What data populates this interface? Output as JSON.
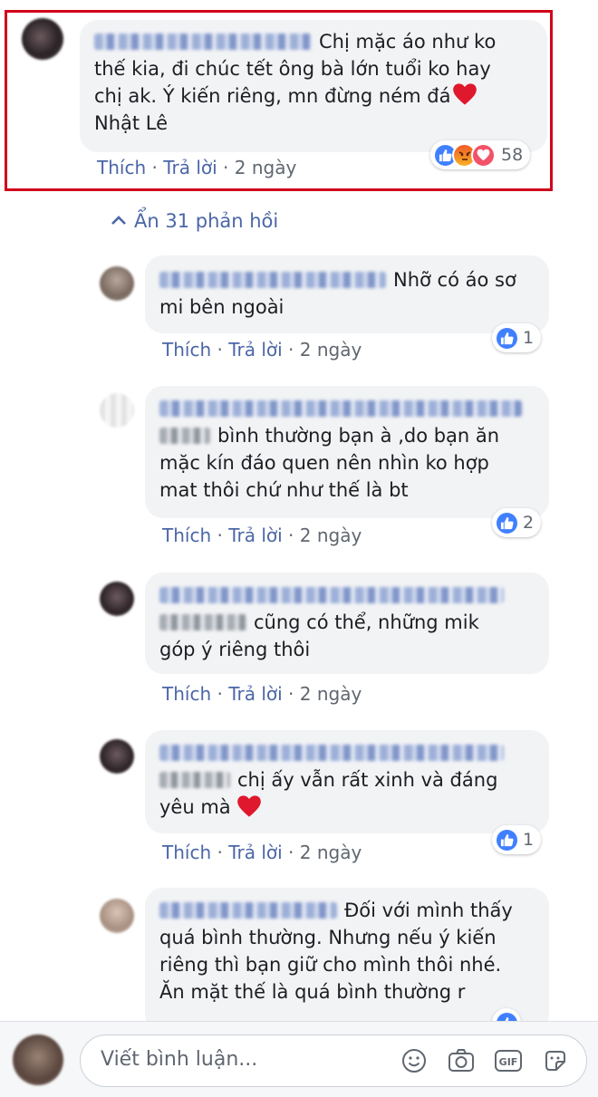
{
  "main_comment": {
    "text_line1": "Chị mặc áo như ko",
    "text_line2": "thế kia, đi chúc tết ông bà lớn tuổi ko hay",
    "text_line3": "chị ak. Ý kiến riêng, mn đừng ném đá",
    "text_line4": "Nhật Lê",
    "like_label": "Thích",
    "reply_label": "Trả lời",
    "time": "2 ngày",
    "reaction_count": "58",
    "reaction_icons": [
      "like-icon",
      "angry-icon",
      "love-icon"
    ]
  },
  "hide_replies_label": "Ẩn 31 phản hồi",
  "replies": [
    {
      "line1": "Nhỡ có áo sơ",
      "line2": "mi bên ngoài",
      "like_label": "Thích",
      "reply_label": "Trả lời",
      "time": "2 ngày",
      "reaction_count": "1"
    },
    {
      "line1": "bình thường bạn à ,do bạn ăn",
      "line2": "mặc kín đáo quen nên nhìn ko hợp",
      "line3": "mat thôi chứ như thế là bt",
      "like_label": "Thích",
      "reply_label": "Trả lời",
      "time": "2 ngày",
      "reaction_count": "2"
    },
    {
      "line1": "cũng có thể, những mik",
      "line2": "góp ý riêng thôi",
      "like_label": "Thích",
      "reply_label": "Trả lời",
      "time": "2 ngày"
    },
    {
      "line1": "chị ấy vẫn rất xinh và đáng",
      "line2": "yêu mà",
      "like_label": "Thích",
      "reply_label": "Trả lời",
      "time": "2 ngày",
      "reaction_count": "1"
    },
    {
      "line1": "Đối với mình thấy",
      "line2": "quá bình thường. Nhưng nếu ý kiến",
      "line3": "riêng thì bạn giữ cho mình thôi nhé.",
      "line4": "Ăn mặt thế là quá bình thường r"
    }
  ],
  "composer": {
    "placeholder": "Viết bình luận...",
    "icons": [
      "emoji-icon",
      "camera-icon",
      "gif-icon",
      "sticker-icon"
    ],
    "gif_label": "GIF"
  },
  "colors": {
    "highlight_border": "#d0021b",
    "link": "#4b66a7",
    "bubble": "#f2f3f5",
    "like_blue": "#4080ff"
  }
}
